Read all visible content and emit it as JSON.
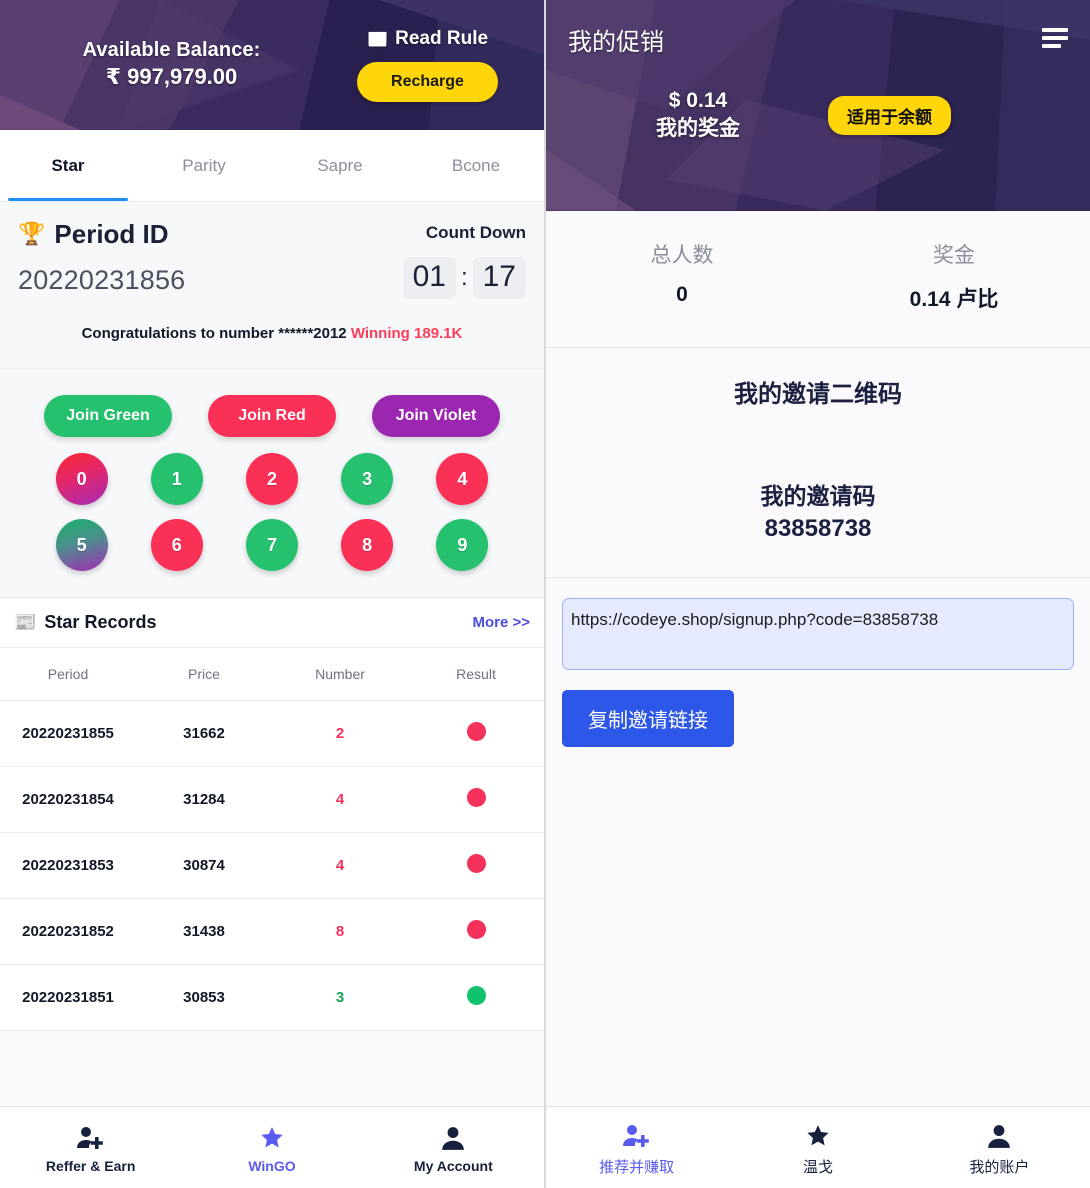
{
  "left": {
    "header": {
      "balance_label": "Available Balance:",
      "balance_amount": "₹ 997,979.00",
      "read_rule_label": "Read Rule",
      "read_rule_icon": "newspaper-icon",
      "recharge_label": "Recharge",
      "recharge_color": "#ffd60a"
    },
    "tabs": [
      {
        "label": "Star",
        "active": true
      },
      {
        "label": "Parity",
        "active": false
      },
      {
        "label": "Sapre",
        "active": false
      },
      {
        "label": "Bcone",
        "active": false
      }
    ],
    "period": {
      "title": "Period ID",
      "trophy_icon": "trophy-icon",
      "id": "20220231856",
      "countdown_label": "Count Down",
      "countdown_minutes": "01",
      "countdown_separator": ":",
      "countdown_seconds": "17"
    },
    "congrats": {
      "prefix": "Congratulations to number ******2012",
      "winning": "Winning 189.1K",
      "winning_color": "#fa3e5a"
    },
    "join_buttons": [
      {
        "label": "Join Green",
        "color": "#25c16f"
      },
      {
        "label": "Join Red",
        "color": "#fa3057"
      },
      {
        "label": "Join Violet",
        "color": "#9b27b0"
      }
    ],
    "numbers": [
      {
        "value": "0",
        "style": "red-violet"
      },
      {
        "value": "1",
        "style": "green"
      },
      {
        "value": "2",
        "style": "red"
      },
      {
        "value": "3",
        "style": "green"
      },
      {
        "value": "4",
        "style": "red"
      },
      {
        "value": "5",
        "style": "green-violet"
      },
      {
        "value": "6",
        "style": "red"
      },
      {
        "value": "7",
        "style": "green"
      },
      {
        "value": "8",
        "style": "red"
      },
      {
        "value": "9",
        "style": "green"
      }
    ],
    "records": {
      "title": "Star Records",
      "title_icon": "newspaper-icon",
      "more_label": "More >>",
      "columns": [
        "Period",
        "Price",
        "Number",
        "Result"
      ],
      "rows": [
        {
          "period": "20220231855",
          "price": "31662",
          "number": "2",
          "number_color": "red",
          "result": "red"
        },
        {
          "period": "20220231854",
          "price": "31284",
          "number": "4",
          "number_color": "red",
          "result": "red"
        },
        {
          "period": "20220231853",
          "price": "30874",
          "number": "4",
          "number_color": "red",
          "result": "red"
        },
        {
          "period": "20220231852",
          "price": "31438",
          "number": "8",
          "number_color": "red",
          "result": "red"
        },
        {
          "period": "20220231851",
          "price": "30853",
          "number": "3",
          "number_color": "green",
          "result": "green"
        }
      ]
    },
    "bottom_nav": [
      {
        "label": "Reffer & Earn",
        "icon": "user-plus-icon",
        "active": false
      },
      {
        "label": "WinGO",
        "icon": "star-icon",
        "active": true
      },
      {
        "label": "My Account",
        "icon": "person-icon",
        "active": false
      }
    ]
  },
  "right": {
    "header": {
      "title": "我的促销",
      "menu_icon": "hamburger-icon",
      "bonus_amount": "$ 0.14",
      "bonus_label": "我的奖金",
      "apply_badge": "适用于余额",
      "apply_badge_color": "#ffd60a"
    },
    "stats": [
      {
        "label": "总人数",
        "value": "0"
      },
      {
        "label": "奖金",
        "value": "0.14 卢比"
      }
    ],
    "invite": {
      "qr_title": "我的邀请二维码",
      "code_label": "我的邀请码",
      "code": "83858738"
    },
    "share": {
      "link": "https://codeye.shop/signup.php?code=83858738",
      "copy_label": "复制邀请链接",
      "copy_color": "#2c57e8"
    },
    "bottom_nav": [
      {
        "label": "推荐并赚取",
        "icon": "user-plus-icon",
        "active": true
      },
      {
        "label": "温戈",
        "icon": "star-icon",
        "active": false
      },
      {
        "label": "我的账户",
        "icon": "person-icon",
        "active": false
      }
    ]
  }
}
